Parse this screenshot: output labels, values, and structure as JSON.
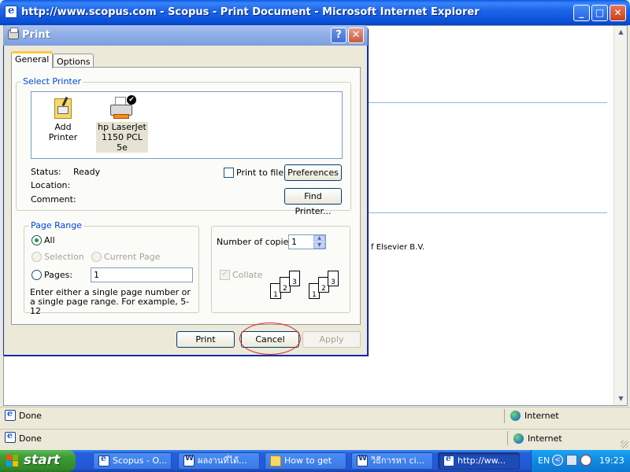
{
  "ie": {
    "title": "http://www.scopus.com - Scopus - Print Document - Microsoft Internet Explorer",
    "page_footer_text": "f Elsevier B.V.",
    "status_text": "Done",
    "zone": "Internet"
  },
  "outer_status": {
    "status_text": "Done",
    "zone": "Internet"
  },
  "dialog": {
    "title": "Print",
    "help_label": "?",
    "close_label": "✕",
    "tabs": [
      {
        "label": "General"
      },
      {
        "label": "Options"
      }
    ],
    "select_printer": {
      "legend": "Select Printer",
      "printers": [
        {
          "label_line1": "Add Printer",
          "label_line2": ""
        },
        {
          "label_line1": "hp LaserJet",
          "label_line2": "1150 PCL 5e"
        }
      ],
      "status_label": "Status:",
      "status_value": "Ready",
      "location_label": "Location:",
      "location_value": "",
      "comment_label": "Comment:",
      "comment_value": "",
      "print_to_file_label": "Print to file",
      "preferences_label": "Preferences",
      "find_printer_label": "Find Printer..."
    },
    "page_range": {
      "legend": "Page Range",
      "all_label": "All",
      "selection_label": "Selection",
      "current_page_label": "Current Page",
      "pages_label": "Pages:",
      "pages_value": "1",
      "hint": "Enter either a single page number or a single page range.  For example, 5-12"
    },
    "copies": {
      "label": "Number of copies:",
      "value": "1",
      "collate_label": "Collate",
      "collate_pages": [
        "1",
        "2",
        "3"
      ]
    },
    "buttons": {
      "print": "Print",
      "cancel": "Cancel",
      "apply": "Apply"
    }
  },
  "taskbar": {
    "start_label": "start",
    "tasks": [
      {
        "label": "Scopus - O..."
      },
      {
        "label": "ผลงานที่ได้..."
      },
      {
        "label": "How to get"
      },
      {
        "label": "วิธีการหา ci..."
      },
      {
        "label": "http://ww..."
      }
    ],
    "language": "EN",
    "chevron": "<",
    "time": "19:23"
  }
}
